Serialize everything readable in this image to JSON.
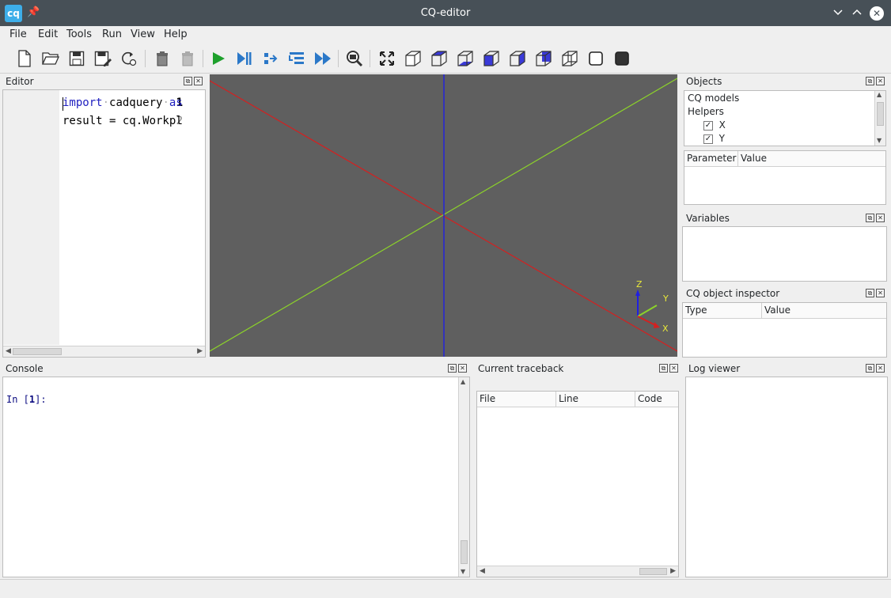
{
  "window": {
    "title": "CQ-editor",
    "app_icon_label": "cq",
    "controls": [
      "minimize",
      "maximize",
      "close"
    ]
  },
  "menu": [
    "File",
    "Edit",
    "Tools",
    "Run",
    "View",
    "Help"
  ],
  "toolbar": {
    "groups": [
      [
        "new-file-icon",
        "open-file-icon",
        "save-icon",
        "save-as-icon",
        "reload-icon"
      ],
      [
        "clear-icon",
        "delete-icon"
      ],
      [
        "run-icon",
        "debug-icon",
        "step-icon",
        "step-in-icon",
        "continue-icon"
      ],
      [
        "inspect-icon"
      ],
      [
        "fit-view-icon",
        "iso-view-icon",
        "top-view-icon",
        "bottom-view-icon",
        "front-view-icon",
        "back-view-icon",
        "left-view-icon",
        "right-view-icon",
        "wireframe-icon",
        "shaded-icon"
      ]
    ]
  },
  "editor": {
    "title": "Editor",
    "lines": [
      {
        "number": "1",
        "keyword": "import",
        "text": "cadquery",
        "trail": "as"
      },
      {
        "number": "2",
        "text": "result = cq.Workpl"
      }
    ]
  },
  "viewer": {
    "axes": {
      "z_label": "Z",
      "y_label": "Y",
      "x_label": "X"
    },
    "colors": {
      "background": "#5f5f5f",
      "x_axis": "#d42020",
      "y_axis": "#8cd22a",
      "z_axis": "#2020e0"
    }
  },
  "objects": {
    "title": "Objects",
    "tree": [
      {
        "label": "CQ models",
        "checked": false
      },
      {
        "label": "Helpers",
        "checked": false
      },
      {
        "label": "X",
        "checked": true
      },
      {
        "label": "Y",
        "checked": true
      }
    ],
    "check_mark": "✓",
    "columns": [
      "Parameter",
      "Value"
    ]
  },
  "variables": {
    "title": "Variables"
  },
  "inspector": {
    "title": "CQ object inspector",
    "columns": [
      "Type",
      "Value"
    ]
  },
  "console": {
    "title": "Console",
    "prompt_prefix": "In [",
    "prompt_number": "1",
    "prompt_suffix": "]:"
  },
  "traceback": {
    "title": "Current traceback",
    "columns": [
      "File",
      "Line",
      "Code"
    ]
  },
  "log": {
    "title": "Log viewer"
  }
}
